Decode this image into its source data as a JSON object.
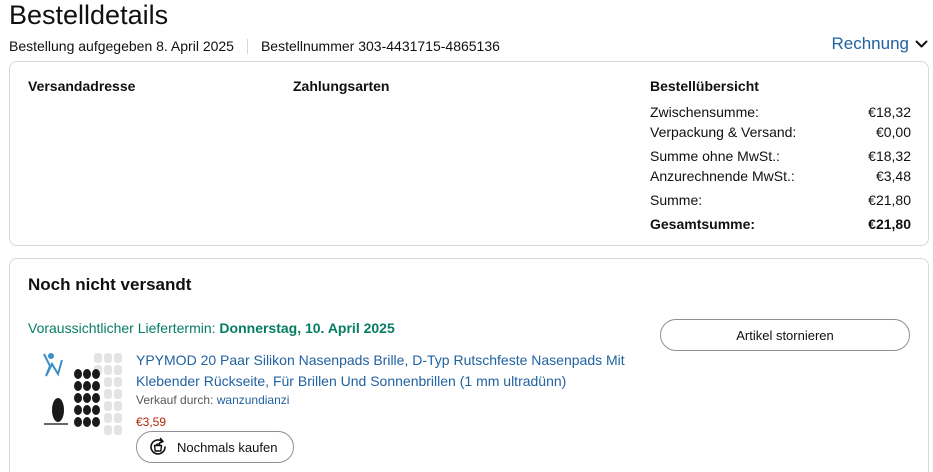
{
  "page": {
    "title": "Bestelldetails",
    "order_date_text": "Bestellung aufgegeben 8. April 2025",
    "order_number_text": "Bestellnummer 303-4431715-4865136",
    "invoice_label": "Rechnung"
  },
  "summary_card": {
    "shipping_address_heading": "Versandadresse",
    "payment_methods_heading": "Zahlungsarten",
    "order_overview_heading": "Bestellübersicht",
    "rows": [
      {
        "label": "Zwischensumme:",
        "value": "€18,32"
      },
      {
        "label": "Verpackung & Versand:",
        "value": "€0,00"
      },
      {
        "label": "Summe ohne MwSt.:",
        "value": "€18,32"
      },
      {
        "label": "Anzurechnende MwSt.:",
        "value": "€3,48"
      },
      {
        "label": "Summe:",
        "value": "€21,80"
      },
      {
        "label": "Gesamtsumme:",
        "value": "€21,80"
      }
    ]
  },
  "shipment": {
    "status_title": "Noch nicht versandt",
    "delivery_prefix": "Voraussichtlicher Liefertermin:",
    "delivery_date": "Donnerstag, 10. April 2025",
    "cancel_label": "Artikel stornieren",
    "product": {
      "title": "YPYMOD 20 Paar Silikon Nasenpads Brille, D-Typ Rutschfeste Nasenpads Mit Klebender Rückseite, Für Brillen Und Sonnenbrillen (1 mm ultradünn)",
      "seller_label": "Verkauf durch:",
      "seller_name": "wanzundianzi",
      "price": "€3,59",
      "buy_again_label": "Nochmals kaufen"
    }
  },
  "colors": {
    "link": "#2162a1",
    "delivery_green": "#067d62",
    "price_red": "#b12704",
    "border": "#d5d9d9"
  },
  "icons": {
    "invoice_chevron": "chevron-down-icon",
    "buy_again": "buy-again-icon"
  }
}
